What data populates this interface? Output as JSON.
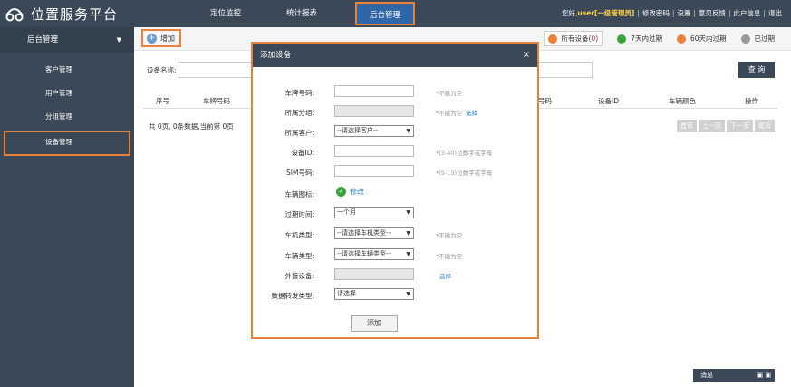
{
  "app": {
    "title": "位置服务平台"
  },
  "nav": [
    {
      "label": "定位监控"
    },
    {
      "label": "统计报表"
    },
    {
      "label": "后台管理",
      "active": true
    }
  ],
  "user": {
    "greeting": "您好,",
    "name": "user[一级管理员]",
    "links": [
      "修改密码",
      "设置",
      "意见反馈",
      "此户信息",
      "退出"
    ]
  },
  "sidebar": {
    "header": "后台管理",
    "items": [
      {
        "label": "客户管理"
      },
      {
        "label": "用户管理"
      },
      {
        "label": "分组管理"
      },
      {
        "label": "设备管理",
        "active": true
      }
    ]
  },
  "toolbar": {
    "add_label": "增加",
    "filters": [
      {
        "label_prefix": "所有设备(",
        "count": "0",
        "label_suffix": ")",
        "color": "#e8823a"
      },
      {
        "label": "7天内过期",
        "color": "#3aa33a"
      },
      {
        "label": "60天内过期",
        "color": "#e8823a"
      },
      {
        "label": "已过期",
        "color": "#999999"
      }
    ]
  },
  "search": {
    "label": "设备名称:",
    "button": "查 询"
  },
  "table": {
    "headers": [
      "序号",
      "车牌号码",
      "号码",
      "设备ID",
      "车辆颜色",
      "操作"
    ],
    "summary": "共 0页, 0条数据,当前第 0页"
  },
  "pager": [
    "首页",
    "上一页",
    "下一页",
    "尾页"
  ],
  "msgbar": {
    "label": "消息",
    "icons": "▣ ▣"
  },
  "modal": {
    "title": "添加设备",
    "close": "×",
    "fields": [
      {
        "label": "车牌号码:",
        "note": "*不能为空"
      },
      {
        "label": "所属分组:",
        "note": "*不能为空",
        "link": "选择"
      },
      {
        "label": "所属客户:",
        "value": "--请选择客户--"
      },
      {
        "label": "设备ID:",
        "note": "*(3-40)位数字或字母"
      },
      {
        "label": "SIM号码:",
        "note": "*(5-13)位数字或字母"
      },
      {
        "label": "车辆图标:",
        "link": "修改"
      },
      {
        "label": "过期时间:",
        "value": "一个月"
      },
      {
        "label": "车机类型:",
        "value": "--请选择车机类型--",
        "note": "*不能为空"
      },
      {
        "label": "车辆类型:",
        "value": "--请选择车辆类型--",
        "note": "*不能为空"
      },
      {
        "label": "外接设备:",
        "link": "选择"
      },
      {
        "label": "数据转发类型:",
        "value": "请选择"
      }
    ],
    "submit": "添加"
  }
}
